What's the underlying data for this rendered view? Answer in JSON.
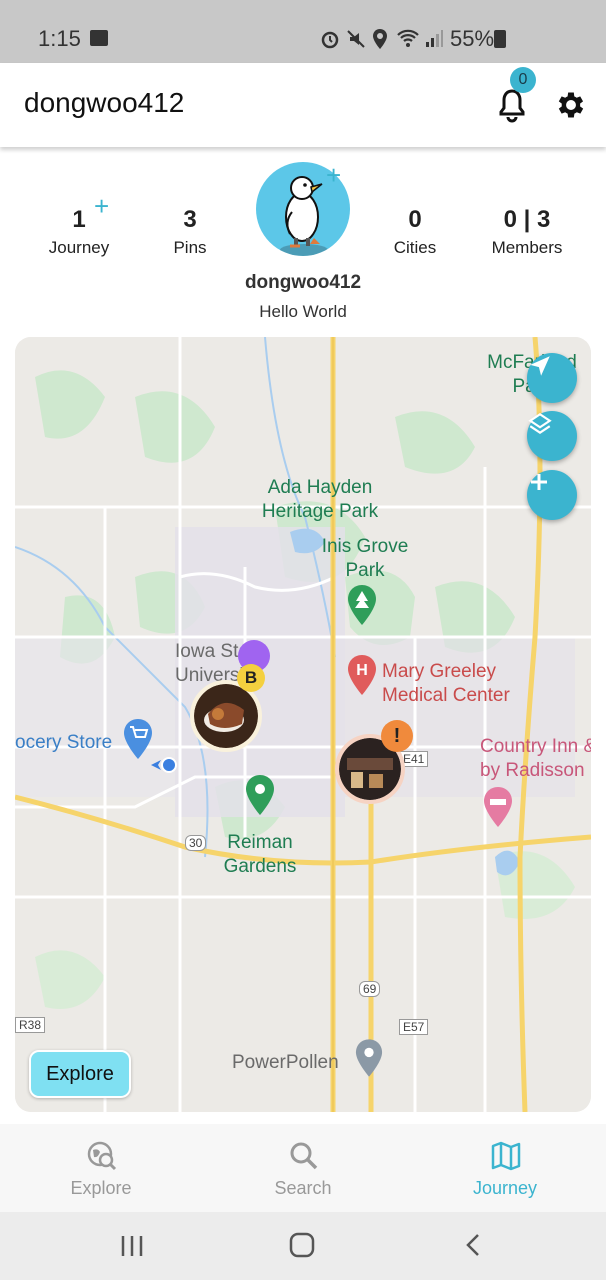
{
  "status_bar": {
    "time": "1:15",
    "battery": "55%"
  },
  "app_bar": {
    "title": "dongwoo412",
    "notification_count": "0"
  },
  "profile": {
    "stats": [
      {
        "value": "1",
        "label": "Journey"
      },
      {
        "value": "3",
        "label": "Pins"
      },
      {
        "value": "0",
        "label": "Cities"
      },
      {
        "value": "0 | 3",
        "label": "Members"
      }
    ],
    "username": "dongwoo412",
    "bio": "Hello World"
  },
  "map": {
    "labels": {
      "ada_hayden": "Ada Hayden\nHeritage Park",
      "inis_grove": "Inis Grove\nPark",
      "iowa_state": "Iowa State\nUniversity",
      "mary_greeley": "Mary Greeley\nMedical Center",
      "grocery": "ocery Store",
      "country_inn": "Country Inn &\nby Radisson",
      "reiman": "Reiman\nGardens",
      "mcfarland": "McFarland\nPark",
      "powerpollen": "PowerPollen",
      "r38": "R38",
      "e57": "E57",
      "e41": "E41",
      "hwy30": "30",
      "hwy69": "69"
    },
    "pin_badges": {
      "university_badge": "B",
      "downtown_badge": "!"
    },
    "explore_button": "Explore",
    "icons": [
      "navigation-arrow-icon",
      "layers-icon",
      "plus-icon"
    ]
  },
  "bottom_nav": {
    "items": [
      {
        "label": "Explore",
        "icon": "explore-globe-icon",
        "active": false
      },
      {
        "label": "Search",
        "icon": "search-icon",
        "active": false
      },
      {
        "label": "Journey",
        "icon": "map-icon",
        "active": true
      }
    ]
  },
  "colors": {
    "accent": "#3bb4cf",
    "explore_button": "#7fe0f2",
    "map_background": "#eceae6"
  }
}
